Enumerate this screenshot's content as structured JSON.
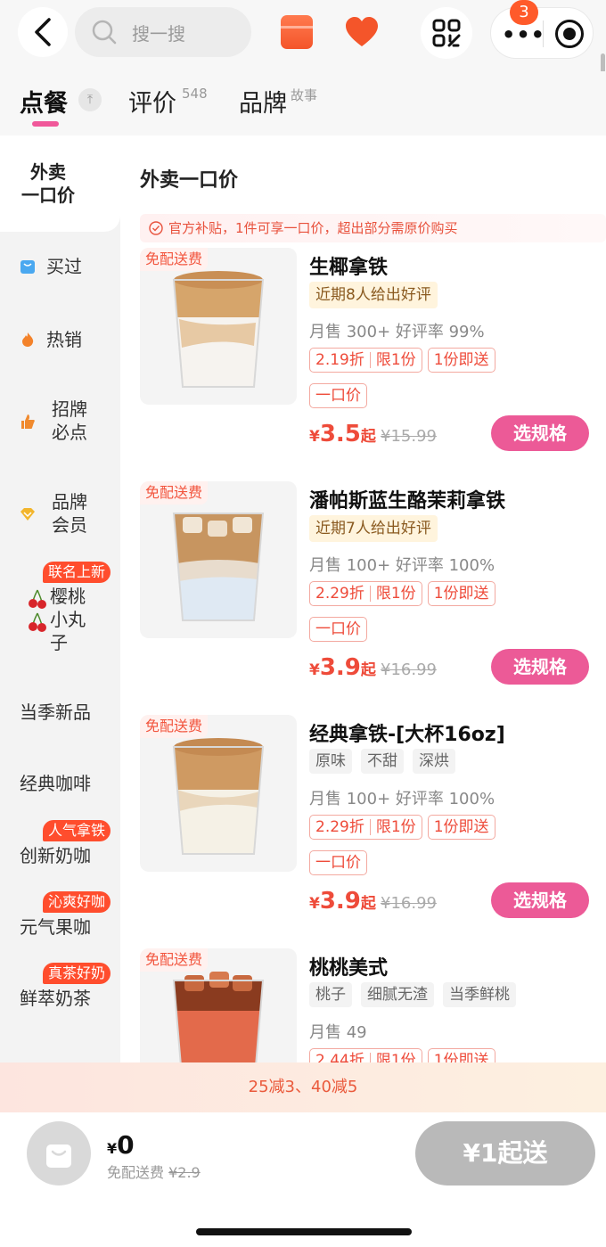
{
  "search": {
    "placeholder": "搜一搜"
  },
  "capsule": {
    "badge_count": "3"
  },
  "tabs": [
    {
      "label": "点餐",
      "sup": ""
    },
    {
      "label": "评价",
      "sup": "548"
    },
    {
      "label": "品牌",
      "sup": "故事"
    }
  ],
  "sidebar": {
    "items": [
      {
        "label": "外卖\n一口价"
      },
      {
        "label": "买过"
      },
      {
        "label": "热销"
      },
      {
        "label": "招牌\n必点"
      },
      {
        "label": "品牌\n会员"
      },
      {
        "label": "樱桃\n小丸\n子",
        "tag": "联名上新"
      },
      {
        "label": "当季新品"
      },
      {
        "label": "经典咖啡"
      },
      {
        "label": "创新奶咖",
        "tag": "人气拿铁"
      },
      {
        "label": "元气果咖",
        "tag": "沁爽好咖"
      },
      {
        "label": "鲜萃奶茶",
        "tag": "真茶好奶"
      }
    ]
  },
  "main": {
    "section_title": "外卖一口价",
    "notice": "官方补贴，1件可享一口价，超出部分需原价购买",
    "products": [
      {
        "free_tag": "免配送费",
        "name": "生椰拿铁",
        "review": "近期8人给出好评",
        "sales": "月售 300+ 好评率 99%",
        "discount": "2.19折",
        "limit": "限1份",
        "min": "1份即送",
        "deal": "一口价",
        "currency": "¥",
        "price": "3.5",
        "qi": "起",
        "original": "¥15.99",
        "spec_label": "选规格"
      },
      {
        "free_tag": "免配送费",
        "name": "潘帕斯蓝生酪茉莉拿铁",
        "review": "近期7人给出好评",
        "sales": "月售 100+ 好评率 100%",
        "discount": "2.29折",
        "limit": "限1份",
        "min": "1份即送",
        "deal": "一口价",
        "currency": "¥",
        "price": "3.9",
        "qi": "起",
        "original": "¥16.99",
        "spec_label": "选规格"
      },
      {
        "free_tag": "免配送费",
        "name": "经典拿铁-[大杯16oz]",
        "attrs": [
          "原味",
          "不甜",
          "深烘"
        ],
        "sales": "月售 100+ 好评率 100%",
        "discount": "2.29折",
        "limit": "限1份",
        "min": "1份即送",
        "deal": "一口价",
        "currency": "¥",
        "price": "3.9",
        "qi": "起",
        "original": "¥16.99",
        "spec_label": "选规格"
      },
      {
        "free_tag": "免配送费",
        "name": "桃桃美式",
        "attrs": [
          "桃子",
          "细腻无渣",
          "当季鲜桃"
        ],
        "sales": "月售 49",
        "discount": "2.44折",
        "limit": "限1份",
        "min": "1份即送"
      }
    ]
  },
  "promo_banner": "25减3、40减5",
  "cart": {
    "currency": "¥",
    "amount": "0",
    "delivery_label": "免配送费",
    "delivery_original": "¥2.9",
    "checkout_label": "¥1起送"
  },
  "colors": {
    "accent_pink": "#ec5a97",
    "price_red": "#ee4b3a",
    "tag_red": "#ff4d2d"
  }
}
